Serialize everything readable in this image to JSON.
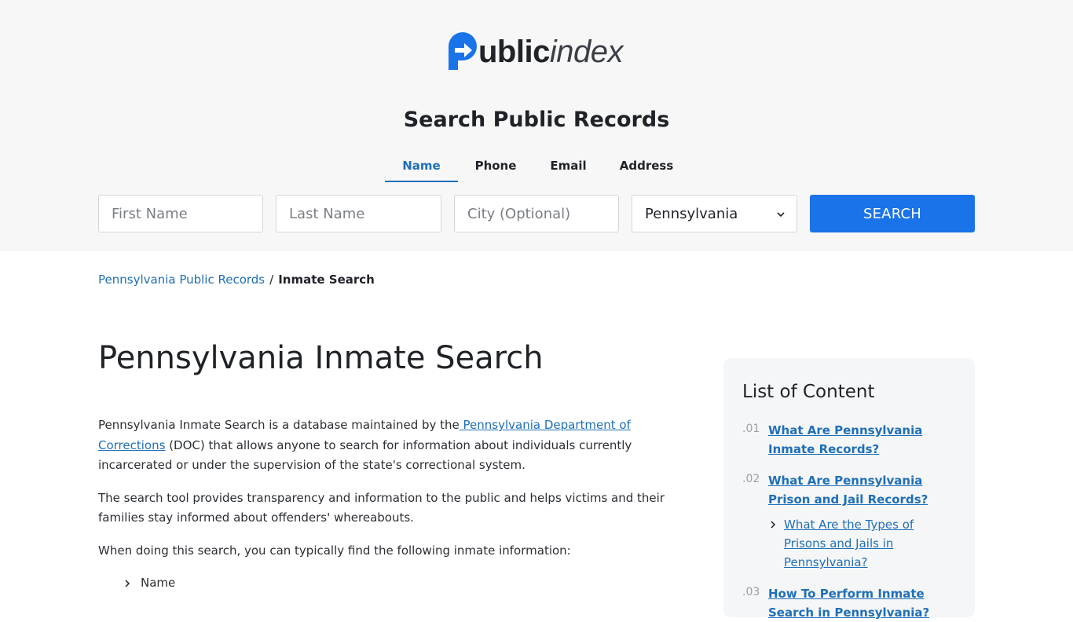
{
  "logo": {
    "bold": "ublic",
    "italic": "index"
  },
  "hero": {
    "title": "Search Public Records"
  },
  "tabs": [
    {
      "label": "Name",
      "active": true
    },
    {
      "label": "Phone"
    },
    {
      "label": "Email"
    },
    {
      "label": "Address"
    }
  ],
  "search": {
    "first_name_placeholder": "First Name",
    "last_name_placeholder": "Last Name",
    "city_placeholder": "City (Optional)",
    "state_selected": "Pennsylvania",
    "button_label": "SEARCH"
  },
  "breadcrumb": {
    "parent": "Pennsylvania Public Records",
    "separator": "/",
    "current": "Inmate Search"
  },
  "page_title": "Pennsylvania Inmate Search",
  "article": {
    "p1_before": "Pennsylvania Inmate Search is a database maintained by the",
    "p1_link": " Pennsylvania Department of Corrections",
    "p1_after": " (DOC) that allows anyone to search for information about individuals currently incarcerated or under the supervision of the state's correctional system.",
    "p2": "The search tool provides transparency and information to the public and helps victims and their families stay informed about offenders' whereabouts.",
    "p3": "When doing this search, you can typically find the following inmate information:",
    "list": [
      "Name"
    ]
  },
  "toc": {
    "title": "List of Content",
    "items": [
      {
        "num": ".01",
        "label": "What Are Pennsylvania Inmate Records?"
      },
      {
        "num": ".02",
        "label": "What Are Pennsylvania Prison and Jail Records?"
      },
      {
        "num": ".03",
        "label": "How To Perform Inmate Search in Pennsylvania?"
      }
    ],
    "sub": "What Are the Types of Prisons and Jails in Pennsylvania?"
  },
  "colors": {
    "accent": "#1a73e8",
    "link": "#1f6fb8",
    "hero_bg": "#f7f7f8"
  }
}
